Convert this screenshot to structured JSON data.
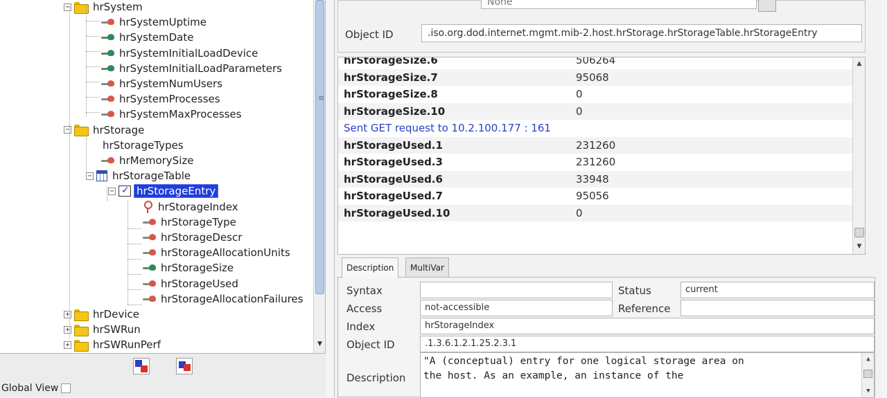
{
  "tree": {
    "items": [
      {
        "label": "hrSystem",
        "type": "folder",
        "indent": 1
      },
      {
        "label": "hrSystemUptime",
        "type": "leaf-red",
        "indent": 2
      },
      {
        "label": "hrSystemDate",
        "type": "leaf-green",
        "indent": 2
      },
      {
        "label": "hrSystemInitialLoadDevice",
        "type": "leaf-green",
        "indent": 2
      },
      {
        "label": "hrSystemInitialLoadParameters",
        "type": "leaf-green",
        "indent": 2
      },
      {
        "label": "hrSystemNumUsers",
        "type": "leaf-red",
        "indent": 2
      },
      {
        "label": "hrSystemProcesses",
        "type": "leaf-red",
        "indent": 2
      },
      {
        "label": "hrSystemMaxProcesses",
        "type": "leaf-red",
        "indent": 2
      },
      {
        "label": "hrStorage",
        "type": "folder",
        "indent": 1
      },
      {
        "label": "hrStorageTypes",
        "type": "plain",
        "indent": 2
      },
      {
        "label": "hrMemorySize",
        "type": "leaf-red",
        "indent": 2
      },
      {
        "label": "hrStorageTable",
        "type": "table",
        "indent": 2
      },
      {
        "label": "hrStorageEntry",
        "type": "entry",
        "indent": 3
      },
      {
        "label": "hrStorageIndex",
        "type": "key",
        "indent": 4
      },
      {
        "label": "hrStorageType",
        "type": "leaf-red",
        "indent": 4
      },
      {
        "label": "hrStorageDescr",
        "type": "leaf-red",
        "indent": 4
      },
      {
        "label": "hrStorageAllocationUnits",
        "type": "leaf-red",
        "indent": 4
      },
      {
        "label": "hrStorageSize",
        "type": "leaf-green",
        "indent": 4
      },
      {
        "label": "hrStorageUsed",
        "type": "leaf-red",
        "indent": 4
      },
      {
        "label": "hrStorageAllocationFailures",
        "type": "leaf-red",
        "indent": 4
      },
      {
        "label": "hrDevice",
        "type": "folder",
        "indent": 1
      },
      {
        "label": "hrSWRun",
        "type": "folder",
        "indent": 1
      },
      {
        "label": "hrSWRunPerf",
        "type": "folder",
        "indent": 1
      }
    ],
    "selected": "hrStorageEntry"
  },
  "global_view_label": "Global View",
  "object_id": {
    "label": "Object ID",
    "value": ".iso.org.dod.internet.mgmt.mib-2.host.hrStorage.hrStorageTable.hrStorageEntry"
  },
  "top_truncated_value": "None",
  "results": [
    {
      "name": "hrStorageSize.6",
      "value": "506264"
    },
    {
      "name": "hrStorageSize.7",
      "value": "95068"
    },
    {
      "name": "hrStorageSize.8",
      "value": "0"
    },
    {
      "name": "hrStorageSize.10",
      "value": "0"
    },
    {
      "message": "Sent GET request to 10.2.100.177 : 161"
    },
    {
      "name": "hrStorageUsed.1",
      "value": "231260"
    },
    {
      "name": "hrStorageUsed.3",
      "value": "231260"
    },
    {
      "name": "hrStorageUsed.6",
      "value": "33948"
    },
    {
      "name": "hrStorageUsed.7",
      "value": "95056"
    },
    {
      "name": "hrStorageUsed.10",
      "value": "0"
    }
  ],
  "tabs": [
    {
      "label": "Description",
      "active": true
    },
    {
      "label": "MultiVar",
      "active": false
    }
  ],
  "detail": {
    "syntax_label": "Syntax",
    "syntax_value": "",
    "status_label": "Status",
    "status_value": "current",
    "access_label": "Access",
    "access_value": "not-accessible",
    "reference_label": "Reference",
    "reference_value": "",
    "index_label": "Index",
    "index_value": "hrStorageIndex",
    "oid_label": "Object ID",
    "oid_value": ".1.3.6.1.2.1.25.2.3.1",
    "description_label": "Description",
    "description_value": "\"A (conceptual) entry for one logical storage area on\nthe host. As an example, an instance of the"
  }
}
